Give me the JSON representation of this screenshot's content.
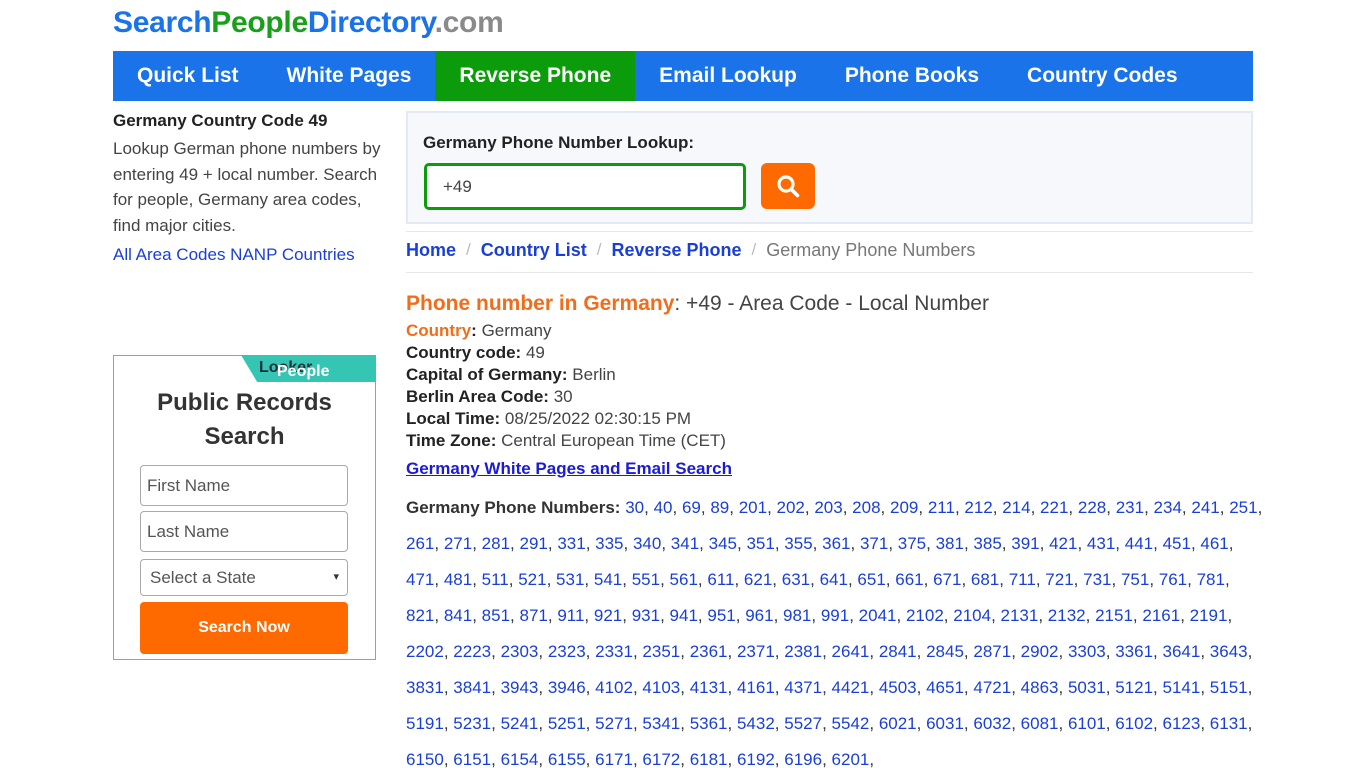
{
  "logo": {
    "part1": "Search",
    "part2": "People",
    "part3": "Directory",
    "part4": ".com"
  },
  "nav": [
    {
      "label": "Quick List",
      "active": false
    },
    {
      "label": "White Pages",
      "active": false
    },
    {
      "label": "Reverse Phone",
      "active": true
    },
    {
      "label": "Email Lookup",
      "active": false
    },
    {
      "label": "Phone Books",
      "active": false
    },
    {
      "label": "Country Codes",
      "active": false
    }
  ],
  "sidebar": {
    "title": "Germany Country Code 49",
    "description": "Lookup German phone numbers by entering 49 + local number. Search for people, Germany area codes, find major cities.",
    "link": "All Area Codes NANP Countries"
  },
  "ad": {
    "brand_part1": "People",
    "brand_part2": "Looker",
    "title": "Public Records Search",
    "first_name_placeholder": "First Name",
    "last_name_placeholder": "Last Name",
    "state_select": "Select a State",
    "button": "Search Now"
  },
  "lookup": {
    "label": "Germany Phone Number Lookup:",
    "value": "+49",
    "search_icon": "search-icon",
    "accent": "#ff6a00",
    "input_border": "#0b9b0b"
  },
  "breadcrumb": {
    "home": "Home",
    "country_list": "Country List",
    "reverse_phone": "Reverse Phone",
    "current": "Germany Phone Numbers"
  },
  "heading": {
    "highlight": "Phone number in Germany",
    "rest": ": +49 - Area Code - Local Number"
  },
  "facts": [
    {
      "key": "Country",
      "value": " Germany",
      "orange": true
    },
    {
      "key": "Country code:",
      "value": " 49",
      "orange": false
    },
    {
      "key": "Capital of Germany:",
      "value": " Berlin",
      "orange": false
    },
    {
      "key": "Berlin Area Code:",
      "value": " 30",
      "orange": false
    },
    {
      "key": "Local Time:",
      "value": " 08/25/2022 02:30:15 PM",
      "orange": false
    },
    {
      "key": "Time Zone:",
      "value": " Central European Time (CET)",
      "orange": false
    }
  ],
  "white_pages_link": "Germany White Pages and Email Search",
  "codes": {
    "label": "Germany Phone Numbers:",
    "items": [
      "30",
      "40",
      "69",
      "89",
      "201",
      "202",
      "203",
      "208",
      "209",
      "211",
      "212",
      "214",
      "221",
      "228",
      "231",
      "234",
      "241",
      "251",
      "261",
      "271",
      "281",
      "291",
      "331",
      "335",
      "340",
      "341",
      "345",
      "351",
      "355",
      "361",
      "371",
      "375",
      "381",
      "385",
      "391",
      "421",
      "431",
      "441",
      "451",
      "461",
      "471",
      "481",
      "511",
      "521",
      "531",
      "541",
      "551",
      "561",
      "611",
      "621",
      "631",
      "641",
      "651",
      "661",
      "671",
      "681",
      "711",
      "721",
      "731",
      "751",
      "761",
      "781",
      "821",
      "841",
      "851",
      "871",
      "911",
      "921",
      "931",
      "941",
      "951",
      "961",
      "981",
      "991",
      "2041",
      "2102",
      "2104",
      "2131",
      "2132",
      "2151",
      "2161",
      "2191",
      "2202",
      "2223",
      "2303",
      "2323",
      "2331",
      "2351",
      "2361",
      "2371",
      "2381",
      "2641",
      "2841",
      "2845",
      "2871",
      "2902",
      "3303",
      "3361",
      "3641",
      "3643",
      "3831",
      "3841",
      "3943",
      "3946",
      "4102",
      "4103",
      "4131",
      "4161",
      "4371",
      "4421",
      "4503",
      "4651",
      "4721",
      "4863",
      "5031",
      "5121",
      "5141",
      "5151",
      "5191",
      "5231",
      "5241",
      "5251",
      "5271",
      "5341",
      "5361",
      "5432",
      "5527",
      "5542",
      "6021",
      "6031",
      "6032",
      "6081",
      "6101",
      "6102",
      "6123",
      "6131",
      "6150",
      "6151",
      "6154",
      "6155",
      "6171",
      "6172",
      "6181",
      "6192",
      "6196",
      "6201"
    ]
  }
}
